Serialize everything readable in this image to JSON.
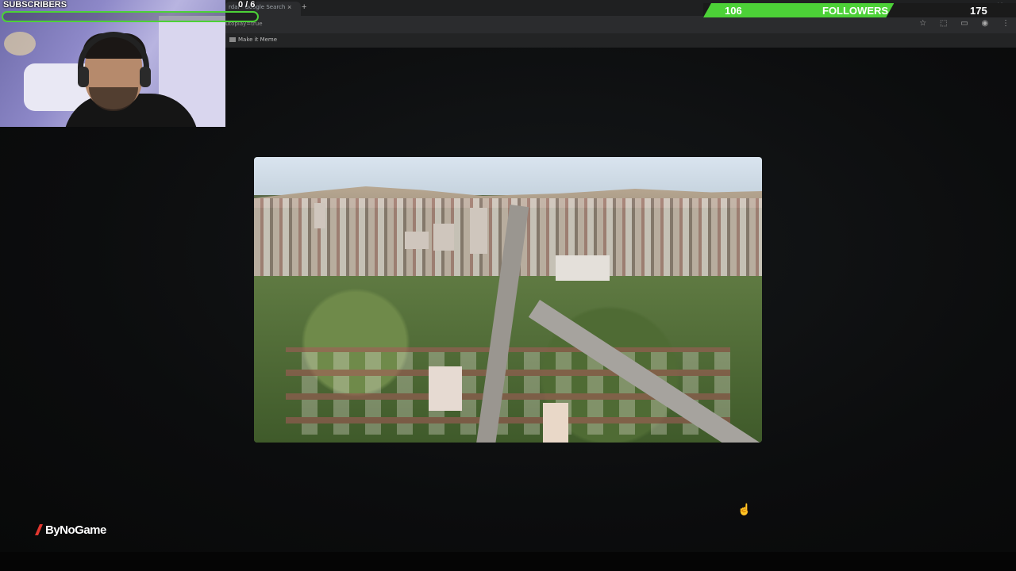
{
  "browser": {
    "tab_title": "rdal - Google Search",
    "tab_close": "×",
    "tab_new": "+",
    "url_fragment": "utoplay=true",
    "bookmark_label": "Make it Meme",
    "toolbar_icons": [
      "star-icon",
      "extensions-icon",
      "cast-icon",
      "profile-icon",
      "menu-icon"
    ],
    "toolbar_glyphs": [
      "☆",
      "⬚",
      "▭",
      "◉",
      "⋮"
    ],
    "window_controls": "— □ ✕"
  },
  "overlay": {
    "subscribers": {
      "label": "SUBSCRIBERS",
      "count": "0 / 6",
      "current": 0,
      "target": 6,
      "bar_color": "#4cd137"
    },
    "followers": {
      "label": "FOLLOWERS",
      "current_text": "106",
      "target_text": "175",
      "current": 106,
      "target": 175,
      "fill_fraction": 0.61,
      "fill_color": "#4cd137"
    },
    "logo_text": "ByNoGame",
    "logo_color": "#e2372f"
  },
  "main": {
    "photo_subject": "aerial city view",
    "background_color": "#0b0c0d"
  }
}
